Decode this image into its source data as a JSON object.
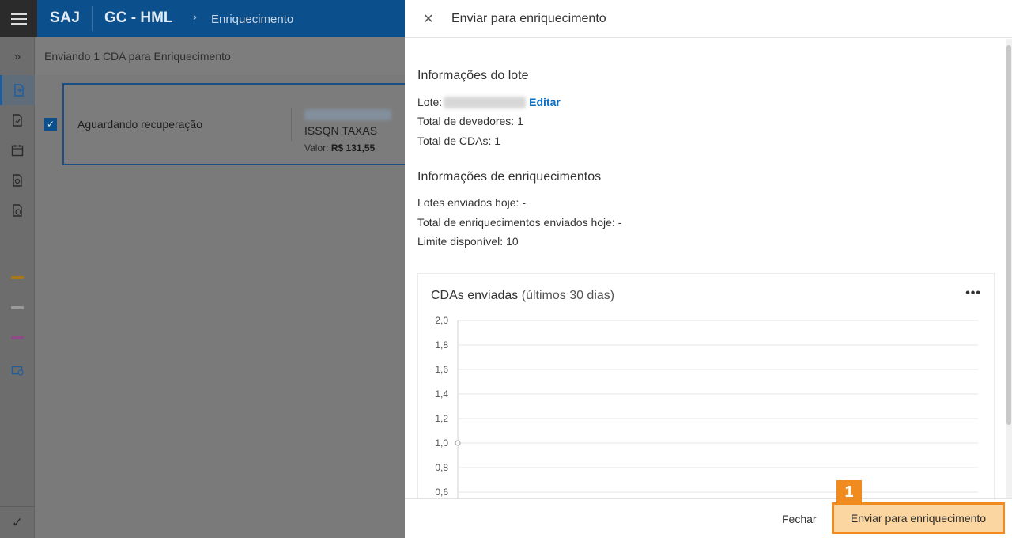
{
  "app": {
    "brand": "SAJ",
    "name": "GC - HML",
    "breadcrumb": "Enriquecimento"
  },
  "subheader": {
    "text": "Enviando 1 CDA para  Enriquecimento"
  },
  "card": {
    "status": "Aguardando recuperação",
    "tax": "ISSQN TAXAS",
    "value_label": "Valor:",
    "value": "R$ 131,55"
  },
  "panel": {
    "title": "Enviar para enriquecimento",
    "lote_section": {
      "title": "Informações do lote",
      "lote_label": "Lote:",
      "edit_label": "Editar",
      "devedores_label": "Total de devedores:",
      "devedores_value": "1",
      "cdas_label": "Total de CDAs:",
      "cdas_value": "1"
    },
    "enrich_section": {
      "title": "Informações de enriquecimentos",
      "lotes_hoje_label": "Lotes enviados hoje:",
      "lotes_hoje_value": "-",
      "enriq_hoje_label": "Total de enriquecimentos enviados hoje:",
      "enriq_hoje_value": "-",
      "limite_label": "Limite disponível:",
      "limite_value": "10"
    },
    "chart_title": "CDAs enviadas",
    "chart_subtitle": "(últimos 30 dias)",
    "more_label": "•••",
    "footer": {
      "close_label": "Fechar",
      "submit_label": "Enviar para enriquecimento"
    },
    "step_badge": "1"
  },
  "chart_data": {
    "type": "line",
    "title": "CDAs enviadas (últimos 30 dias)",
    "y_ticks": [
      "2,0",
      "1,8",
      "1,6",
      "1,4",
      "1,2",
      "1,0",
      "0,8",
      "0,6"
    ],
    "ylim": [
      0.6,
      2.0
    ],
    "series": [
      {
        "values": [
          1.0
        ]
      }
    ],
    "grid": true
  },
  "colors": {
    "topbar": "#0b4f8c",
    "accent": "#f08b1f",
    "link": "#0a6ec4"
  }
}
